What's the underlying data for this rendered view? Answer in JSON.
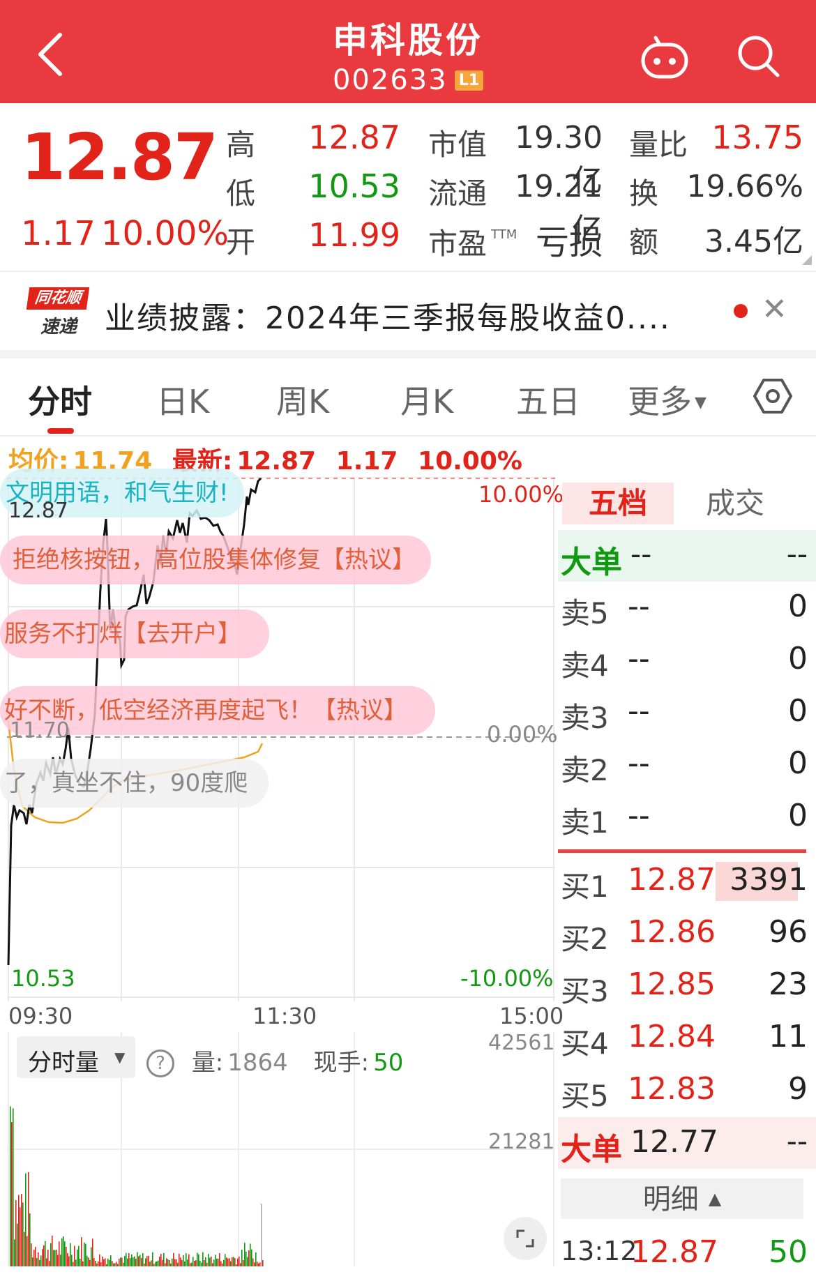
{
  "header": {
    "title": "申科股份",
    "code": "002633",
    "level_badge": "L1",
    "icons": [
      "back-arrow-icon",
      "robot-icon",
      "search-icon"
    ]
  },
  "quote": {
    "price": "12.87",
    "change": "1.17",
    "change_pct": "10.00%",
    "high_label": "高",
    "high": "12.87",
    "low_label": "低",
    "low": "10.53",
    "open_label": "开",
    "open": "11.99",
    "mktcap_label": "市值",
    "mktcap": "19.30亿",
    "float_label": "流通",
    "float": "19.21亿",
    "pe_label": "市盈",
    "pe_sup": "TTM",
    "pe": "亏损",
    "vol_ratio_label": "量比",
    "vol_ratio": "13.75",
    "turnover_label": "换",
    "turnover": "19.66%",
    "amount_label": "额",
    "amount": "3.45亿"
  },
  "news": {
    "logo_line1": "同花顺",
    "logo_line2": "速递",
    "text": "业绩披露：2024年三季报每股收益0...."
  },
  "tabs": [
    "分时",
    "日K",
    "周K",
    "月K",
    "五日",
    "更多"
  ],
  "chart_info": {
    "avg_label": "均价:",
    "avg": "11.74",
    "latest_label": "最新:",
    "latest": "12.87",
    "change": "1.17",
    "change_pct": "10.00%"
  },
  "chart_labels": {
    "top_price": "12.87",
    "top_pct": "10.00%",
    "mid_price": "11.70",
    "mid_pct": "0.00%",
    "bottom_price": "10.53",
    "bottom_pct": "-10.00%",
    "t_start": "09:30",
    "t_mid": "11:30",
    "t_end": "15:00"
  },
  "tags": [
    "文明用语，和气生财!",
    "拒绝核按钮，高位股集体修复【热议】",
    "服务不打烊【去开户】",
    "好不断，低空经济再度起飞！【热议】",
    "了，真坐不住，90度爬"
  ],
  "volume": {
    "selector": "分时量",
    "vol_label": "量:",
    "vol": "1864",
    "hand_label": "现手:",
    "hand": "50",
    "max": "42561",
    "mid": "21281"
  },
  "order_book": {
    "tab_active": "五档",
    "tab_other": "成交",
    "big_top": {
      "label": "大单",
      "px": "--",
      "qty": "--"
    },
    "asks": [
      {
        "label": "卖5",
        "px": "--",
        "qty": "0"
      },
      {
        "label": "卖4",
        "px": "--",
        "qty": "0"
      },
      {
        "label": "卖3",
        "px": "--",
        "qty": "0"
      },
      {
        "label": "卖2",
        "px": "--",
        "qty": "0"
      },
      {
        "label": "卖1",
        "px": "--",
        "qty": "0"
      }
    ],
    "bids": [
      {
        "label": "买1",
        "px": "12.87",
        "qty": "3391"
      },
      {
        "label": "买2",
        "px": "12.86",
        "qty": "96"
      },
      {
        "label": "买3",
        "px": "12.85",
        "qty": "23"
      },
      {
        "label": "买4",
        "px": "12.84",
        "qty": "11"
      },
      {
        "label": "买5",
        "px": "12.83",
        "qty": "9"
      }
    ],
    "big_bot": {
      "label": "大单",
      "px": "12.77",
      "qty": "--"
    },
    "detail": "明细",
    "last_trade": {
      "time": "13:12",
      "px": "12.87",
      "qty": "50"
    }
  },
  "colors": {
    "brand_red": "#e83a3f",
    "up": "#e2231a",
    "down": "#119911",
    "avg": "#f0a21f"
  }
}
